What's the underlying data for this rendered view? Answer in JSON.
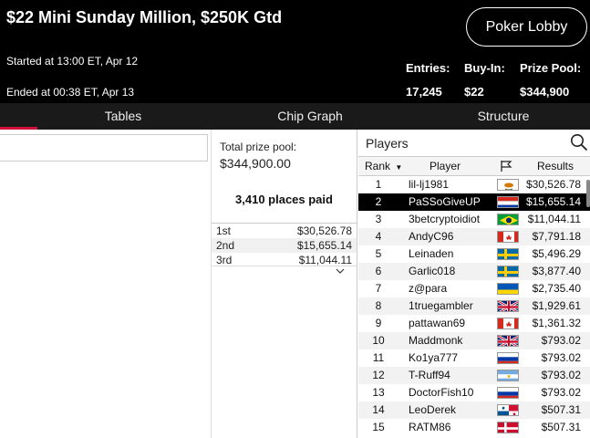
{
  "header": {
    "title": "$22 Mini Sunday Million, $250K Gtd",
    "lobby_button": "Poker Lobby",
    "started": "Started at 13:00 ET, Apr 12",
    "ended": "Ended at 00:38 ET, Apr 13",
    "stats": {
      "entries_label": "Entries:",
      "entries_value": "17,245",
      "buyin_label": "Buy-In:",
      "buyin_value": "$22",
      "prize_label": "Prize Pool:",
      "prize_value": "$344,900"
    }
  },
  "tabs": [
    "Tables",
    "Chip Graph",
    "Structure"
  ],
  "prize": {
    "total_label": "Total prize pool:",
    "total_value": "$344,900.00",
    "places_paid": "3,410 places paid",
    "payouts": [
      {
        "place": "1st",
        "amount": "$30,526.78"
      },
      {
        "place": "2nd",
        "amount": "$15,655.14"
      },
      {
        "place": "3rd",
        "amount": "$11,044.11"
      }
    ]
  },
  "players": {
    "title": "Players",
    "columns": {
      "rank": "Rank",
      "player": "Player",
      "results": "Results"
    },
    "rows": [
      {
        "rank": "1",
        "name": "lil-lj1981",
        "flag": "cyprus",
        "result": "$30,526.78"
      },
      {
        "rank": "2",
        "name": "PaSSoGiveUP",
        "flag": "paraguay",
        "result": "$15,655.14"
      },
      {
        "rank": "3",
        "name": "3betcryptoidiot",
        "flag": "brazil",
        "result": "$11,044.11"
      },
      {
        "rank": "4",
        "name": "AndyC96",
        "flag": "canada",
        "result": "$7,791.18"
      },
      {
        "rank": "5",
        "name": "Leinaden",
        "flag": "sweden",
        "result": "$5,496.29"
      },
      {
        "rank": "6",
        "name": "Garlic018",
        "flag": "sweden",
        "result": "$3,877.40"
      },
      {
        "rank": "7",
        "name": "z@para",
        "flag": "ukraine",
        "result": "$2,735.40"
      },
      {
        "rank": "8",
        "name": "1truegambler",
        "flag": "uk",
        "result": "$1,929.61"
      },
      {
        "rank": "9",
        "name": "pattawan69",
        "flag": "canada",
        "result": "$1,361.32"
      },
      {
        "rank": "10",
        "name": "Maddmonk",
        "flag": "uk",
        "result": "$793.02"
      },
      {
        "rank": "11",
        "name": "Ko1ya777",
        "flag": "russia",
        "result": "$793.02"
      },
      {
        "rank": "12",
        "name": "T-Ruff94",
        "flag": "argentina",
        "result": "$793.02"
      },
      {
        "rank": "13",
        "name": "DoctorFish10",
        "flag": "russia",
        "result": "$793.02"
      },
      {
        "rank": "14",
        "name": "LeoDerek",
        "flag": "panama",
        "result": "$507.31"
      },
      {
        "rank": "15",
        "name": "RATM86",
        "flag": "denmark",
        "result": "$507.31"
      }
    ],
    "selected_rank": "2"
  }
}
